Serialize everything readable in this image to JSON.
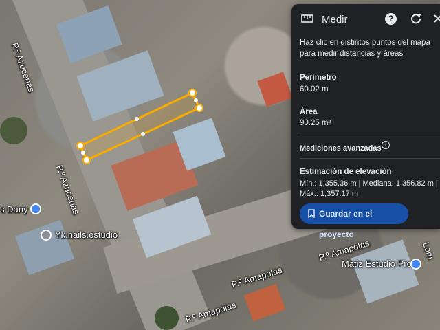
{
  "panel": {
    "title": "Medir",
    "instructions": "Haz clic en distintos puntos del mapa para medir distancias y áreas",
    "perimeter_label": "Perímetro",
    "perimeter_value": "60.02 m",
    "area_label": "Área",
    "area_value": "90.25 m²",
    "advanced_label": "Mediciones avanzadas",
    "elevation_title": "Estimación de elevación",
    "elevation_line1": "Mín.: 1,355.36 m | Mediana: 1,356.82 m |",
    "elevation_line2": "Máx.: 1,357.17 m",
    "save_label": "Guardar en el proyecto",
    "icons": [
      "ruler-icon",
      "help-icon",
      "reset-icon",
      "close-icon",
      "info-icon",
      "bookmark-icon"
    ]
  },
  "map": {
    "streets": {
      "azucenas_top": "P.º Azucenas",
      "azucenas_mid": "P.º Azucenas",
      "amapolas_right": "P.º Amapolas",
      "amapolas_mid": "P.º Amapolas",
      "amapolas_bottom": "P.º Amapolas",
      "lomas_edge": "Lom"
    },
    "places": {
      "dany": "s Dany",
      "yk_nails": "Yk.nails.estudio",
      "matiz": "Matiz Estudio Pro"
    }
  },
  "colors": {
    "measure_line": "#f9ab00",
    "panel_bg": "#202124",
    "save_button": "#174ea6",
    "pin_blue": "#4285f4"
  }
}
